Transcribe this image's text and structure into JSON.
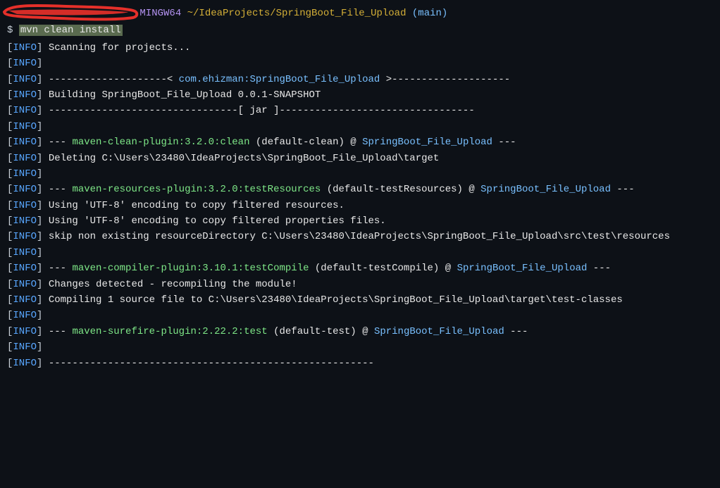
{
  "prompt": {
    "mingw": "MINGW64",
    "path": "~/IdeaProjects/SpringBoot_File_Upload",
    "branch_open": "(",
    "branch": "main",
    "branch_close": ")",
    "dollar": "$",
    "command": "mvn clean install"
  },
  "lines": [
    {
      "segments": [
        {
          "t": "info"
        },
        {
          "txt": "Scanning for projects...",
          "c": "white"
        }
      ]
    },
    {
      "segments": [
        {
          "t": "info"
        }
      ]
    },
    {
      "segments": [
        {
          "t": "info"
        },
        {
          "txt": "--------------------< ",
          "c": "dash"
        },
        {
          "txt": "com.ehizman:SpringBoot_File_Upload",
          "c": "cyan"
        },
        {
          "txt": " >--------------------",
          "c": "dash"
        }
      ]
    },
    {
      "segments": [
        {
          "t": "info"
        },
        {
          "txt": "Building SpringBoot_File_Upload 0.0.1-SNAPSHOT",
          "c": "white"
        }
      ]
    },
    {
      "segments": [
        {
          "t": "info"
        },
        {
          "txt": "--------------------------------[ jar ]---------------------------------",
          "c": "dash"
        }
      ]
    },
    {
      "segments": [
        {
          "t": "info"
        }
      ]
    },
    {
      "segments": [
        {
          "t": "info"
        },
        {
          "txt": "--- ",
          "c": "dash"
        },
        {
          "txt": "maven-clean-plugin:3.2.0:clean",
          "c": "green"
        },
        {
          "txt": " (default-clean)",
          "c": "white"
        },
        {
          "txt": " @ ",
          "c": "white"
        },
        {
          "txt": "SpringBoot_File_Upload",
          "c": "cyan"
        },
        {
          "txt": " ---",
          "c": "dash"
        }
      ]
    },
    {
      "segments": [
        {
          "t": "info"
        },
        {
          "txt": "Deleting C:\\Users\\23480\\IdeaProjects\\SpringBoot_File_Upload\\target",
          "c": "white"
        }
      ]
    },
    {
      "segments": [
        {
          "t": "info"
        }
      ]
    },
    {
      "segments": [
        {
          "t": "info"
        },
        {
          "txt": "--- ",
          "c": "dash"
        },
        {
          "txt": "maven-resources-plugin:3.2.0:testResources",
          "c": "green"
        },
        {
          "txt": " (default-testResources)",
          "c": "white"
        },
        {
          "txt": " @ ",
          "c": "white"
        },
        {
          "txt": "SpringBoot_File_Upload",
          "c": "cyan"
        },
        {
          "txt": " ---",
          "c": "dash"
        }
      ]
    },
    {
      "segments": [
        {
          "t": "info"
        },
        {
          "txt": "Using 'UTF-8' encoding to copy filtered resources.",
          "c": "white"
        }
      ]
    },
    {
      "segments": [
        {
          "t": "info"
        },
        {
          "txt": "Using 'UTF-8' encoding to copy filtered properties files.",
          "c": "white"
        }
      ]
    },
    {
      "segments": [
        {
          "t": "info"
        },
        {
          "txt": "skip non existing resourceDirectory C:\\Users\\23480\\IdeaProjects\\SpringBoot_File_Upload\\src\\test\\resources",
          "c": "white"
        }
      ]
    },
    {
      "segments": [
        {
          "t": "info"
        }
      ]
    },
    {
      "segments": [
        {
          "t": "info"
        },
        {
          "txt": "--- ",
          "c": "dash"
        },
        {
          "txt": "maven-compiler-plugin:3.10.1:testCompile",
          "c": "green"
        },
        {
          "txt": " (default-testCompile)",
          "c": "white"
        },
        {
          "txt": " @ ",
          "c": "white"
        },
        {
          "txt": "SpringBoot_File_Upload",
          "c": "cyan"
        },
        {
          "txt": " ---",
          "c": "dash"
        }
      ]
    },
    {
      "segments": [
        {
          "t": "info"
        },
        {
          "txt": "Changes detected - recompiling the module!",
          "c": "white"
        }
      ]
    },
    {
      "segments": [
        {
          "t": "info"
        },
        {
          "txt": "Compiling 1 source file to C:\\Users\\23480\\IdeaProjects\\SpringBoot_File_Upload\\target\\test-classes",
          "c": "white"
        }
      ]
    },
    {
      "segments": [
        {
          "t": "info"
        }
      ]
    },
    {
      "segments": [
        {
          "t": "info"
        },
        {
          "txt": "--- ",
          "c": "dash"
        },
        {
          "txt": "maven-surefire-plugin:2.22.2:test",
          "c": "green"
        },
        {
          "txt": " (default-test)",
          "c": "white"
        },
        {
          "txt": " @ ",
          "c": "white"
        },
        {
          "txt": "SpringBoot_File_Upload",
          "c": "cyan"
        },
        {
          "txt": " ---",
          "c": "dash"
        }
      ]
    },
    {
      "segments": [
        {
          "t": "info"
        }
      ]
    },
    {
      "segments": [
        {
          "t": "info"
        },
        {
          "txt": "-------------------------------------------------------",
          "c": "dash"
        }
      ]
    }
  ],
  "info_label": "INFO"
}
